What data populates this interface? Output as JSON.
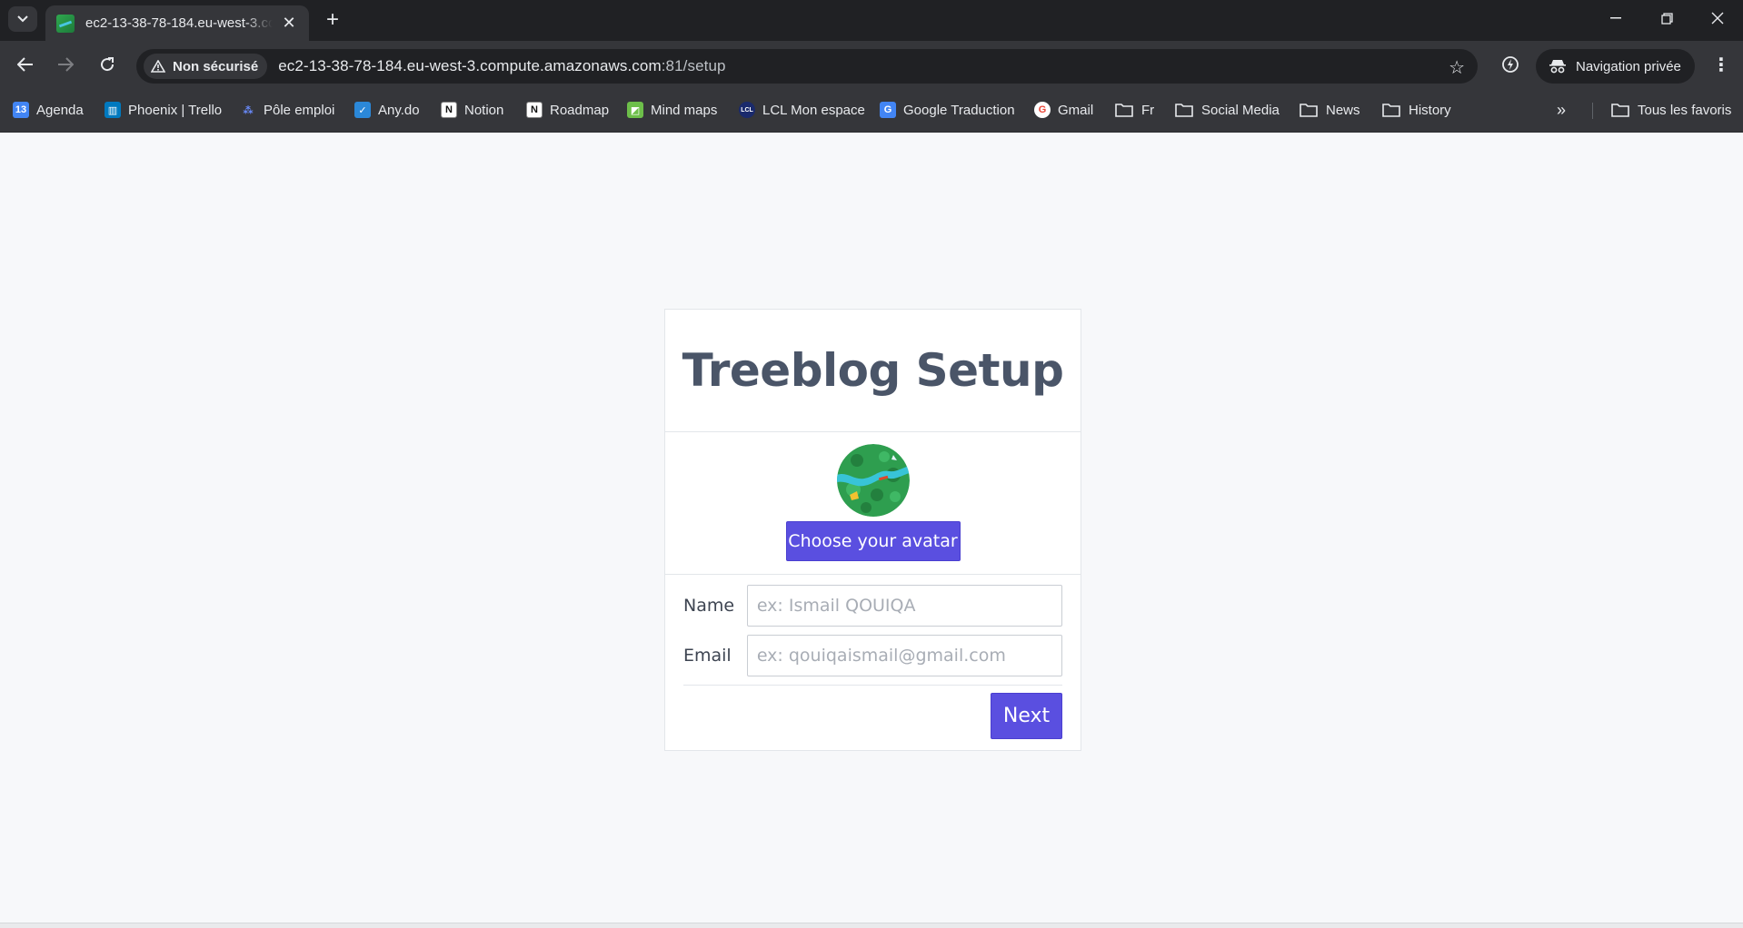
{
  "browser": {
    "tab_title": "ec2-13-38-78-184.eu-west-3.compute.amazonaws.com",
    "security_label": "Non sécurisé",
    "url_host": "ec2-13-38-78-184.eu-west-3.compute.amazonaws.com",
    "url_path": ":81/setup",
    "incognito_label": "Navigation privée",
    "bookmarks": [
      {
        "label": "Agenda",
        "icon": "calendar-icon"
      },
      {
        "label": "Phoenix | Trello",
        "icon": "trello-icon"
      },
      {
        "label": "Pôle emploi",
        "icon": "pole-emploi-icon"
      },
      {
        "label": "Any.do",
        "icon": "anydo-icon"
      },
      {
        "label": "Notion",
        "icon": "notion-icon"
      },
      {
        "label": "Roadmap",
        "icon": "notion-icon"
      },
      {
        "label": "Mind maps",
        "icon": "mindmap-icon"
      },
      {
        "label": "LCL Mon espace",
        "icon": "lcl-icon"
      },
      {
        "label": "Google Traduction",
        "icon": "translate-icon"
      },
      {
        "label": "Gmail",
        "icon": "google-icon"
      },
      {
        "label": "Fr",
        "icon": "folder-icon"
      },
      {
        "label": "Social Media",
        "icon": "folder-icon"
      },
      {
        "label": "News",
        "icon": "folder-icon"
      },
      {
        "label": "History",
        "icon": "folder-icon"
      }
    ],
    "all_bookmarks_label": "Tous les favoris"
  },
  "setup": {
    "title": "Treeblog Setup",
    "avatar_button": "Choose your avatar",
    "name_label": "Name",
    "name_placeholder": "ex: Ismail QOUIQA",
    "email_label": "Email",
    "email_placeholder": "ex: qouiqaismail@gmail.com",
    "next_button": "Next"
  },
  "colors": {
    "primary": "#5a4fe0",
    "title_text": "#4a5568",
    "page_bg": "#f7f8fa",
    "chrome_dark": "#202124",
    "chrome_toolbar": "#35363a"
  }
}
